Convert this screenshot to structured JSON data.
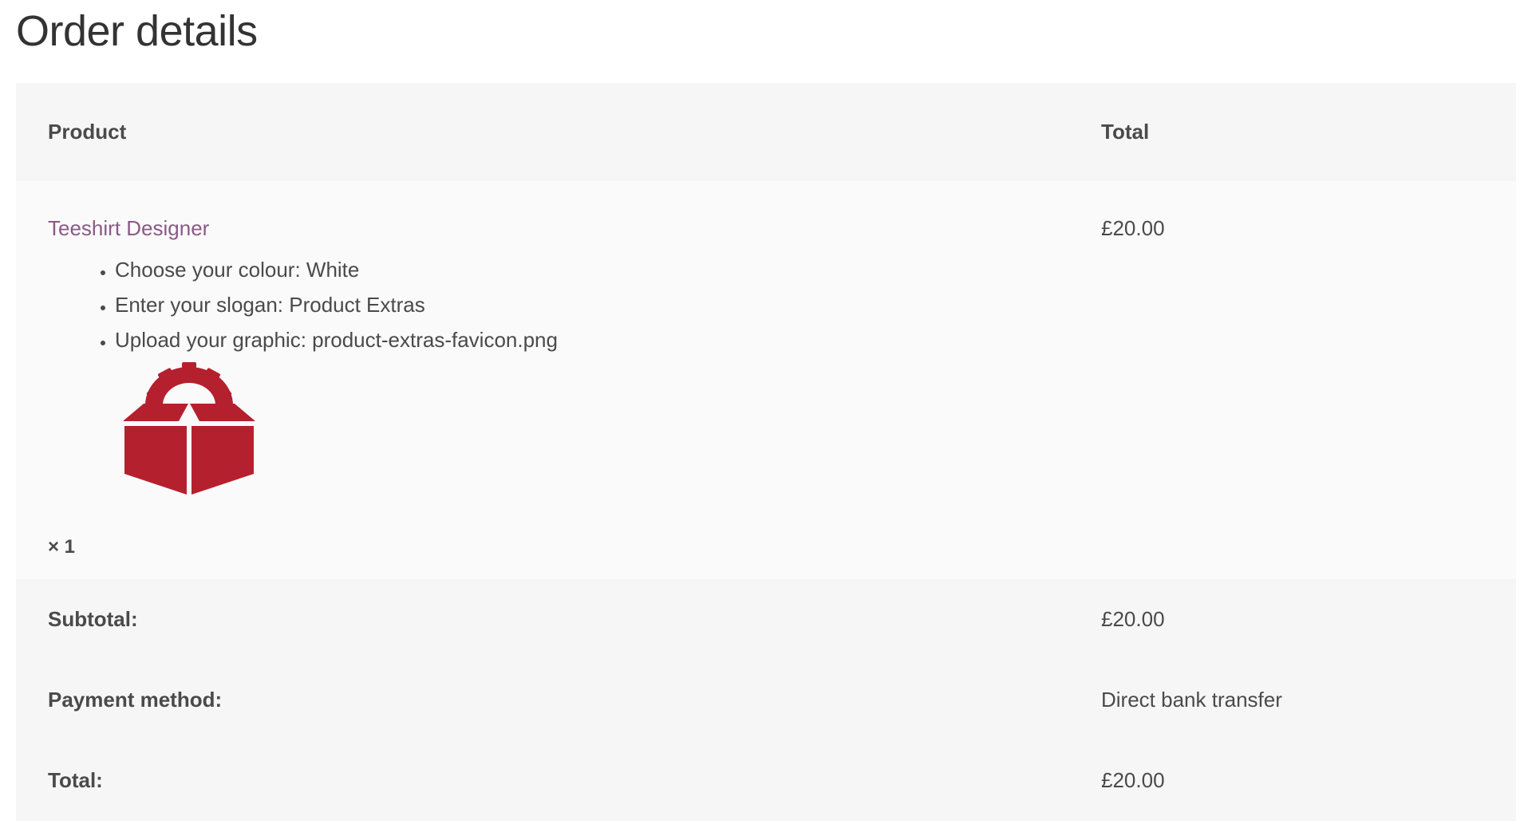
{
  "page": {
    "title": "Order details"
  },
  "table": {
    "headers": {
      "product": "Product",
      "total": "Total"
    },
    "item": {
      "name": "Teeshirt Designer",
      "meta": [
        {
          "label": "Choose your colour:",
          "value": "White"
        },
        {
          "label": "Enter your slogan:",
          "value": "Product Extras"
        },
        {
          "label": "Upload your graphic:",
          "value": "product-extras-favicon.png"
        }
      ],
      "meta_lines": [
        "Choose your colour: White",
        "Enter your slogan: Product Extras",
        "Upload your graphic: product-extras-favicon.png"
      ],
      "graphic_icon": "gear-box-icon",
      "quantity": "× 1",
      "total": "£20.00"
    },
    "footer": [
      {
        "label": "Subtotal:",
        "value": "£20.00"
      },
      {
        "label": "Payment method:",
        "value": "Direct bank transfer"
      },
      {
        "label": "Total:",
        "value": "£20.00"
      }
    ]
  },
  "colors": {
    "product_link": "#8a5a85",
    "graphic_red": "#b5202e",
    "header_bg": "#f6f6f6",
    "item_bg": "#fafafa"
  }
}
